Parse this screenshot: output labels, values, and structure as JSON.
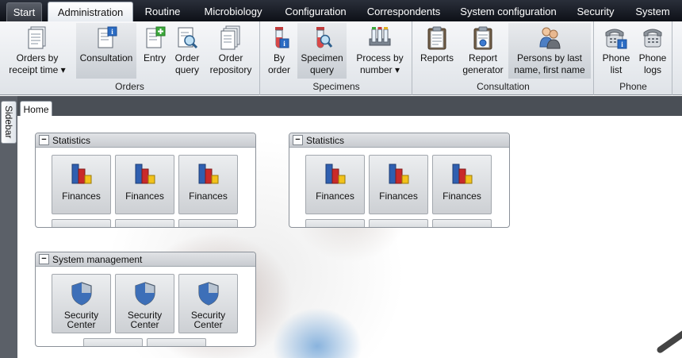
{
  "menu": {
    "tabs": [
      {
        "label": "Start"
      },
      {
        "label": "Administration"
      },
      {
        "label": "Routine"
      },
      {
        "label": "Microbiology"
      },
      {
        "label": "Configuration"
      },
      {
        "label": "Correspondents"
      },
      {
        "label": "System configuration"
      },
      {
        "label": "Security"
      },
      {
        "label": "System"
      }
    ],
    "active_index": 1
  },
  "ribbon": {
    "groups": [
      {
        "label": "Orders",
        "buttons": [
          {
            "label": "Orders by\nreceipt time ▾",
            "icon": "document-list-icon"
          },
          {
            "label": "Consultation",
            "icon": "document-info-icon"
          },
          {
            "label": "Entry",
            "icon": "document-add-icon"
          },
          {
            "label": "Order\nquery",
            "icon": "document-search-icon"
          },
          {
            "label": "Order\nrepository",
            "icon": "document-stack-icon"
          }
        ]
      },
      {
        "label": "Specimens",
        "buttons": [
          {
            "label": "By\norder",
            "icon": "test-tube-info-icon"
          },
          {
            "label": "Specimen\nquery",
            "icon": "test-tube-search-icon"
          },
          {
            "label": "Process by\nnumber ▾",
            "icon": "test-tube-rack-icon"
          }
        ]
      },
      {
        "label": "Consultation",
        "buttons": [
          {
            "label": "Reports",
            "icon": "clipboard-icon"
          },
          {
            "label": "Report\ngenerator",
            "icon": "clipboard-gear-icon"
          },
          {
            "label": "Persons by last\nname, first name",
            "icon": "persons-icon"
          }
        ]
      },
      {
        "label": "Phone",
        "buttons": [
          {
            "label": "Phone\nlist",
            "icon": "phone-info-icon"
          },
          {
            "label": "Phone\nlogs",
            "icon": "phone-icon"
          }
        ]
      }
    ]
  },
  "sidebar": {
    "label": "Sidebar"
  },
  "document": {
    "tab_label": "Home"
  },
  "panels": [
    {
      "title": "Statistics",
      "tiles": [
        {
          "label": "Finances",
          "icon": "bar-chart-icon"
        },
        {
          "label": "Finances",
          "icon": "bar-chart-icon"
        },
        {
          "label": "Finances",
          "icon": "bar-chart-icon"
        }
      ]
    },
    {
      "title": "Statistics",
      "tiles": [
        {
          "label": "Finances",
          "icon": "bar-chart-icon"
        },
        {
          "label": "Finances",
          "icon": "bar-chart-icon"
        },
        {
          "label": "Finances",
          "icon": "bar-chart-icon"
        }
      ]
    },
    {
      "title": "System management",
      "tiles": [
        {
          "label": "Security\nCenter",
          "icon": "shield-icon"
        },
        {
          "label": "Security\nCenter",
          "icon": "shield-icon"
        },
        {
          "label": "Security\nCenter",
          "icon": "shield-icon"
        }
      ]
    }
  ],
  "collapse_glyph": "−"
}
